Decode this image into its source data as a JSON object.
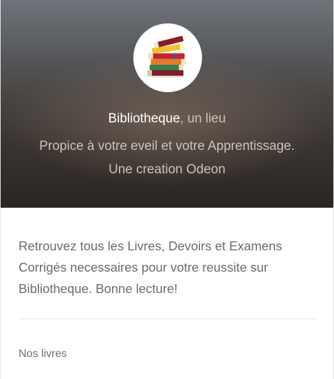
{
  "hero": {
    "brand": "Bibliotheque",
    "line1_rest": ", un lieu",
    "line2": "Propice à votre eveil et votre Apprentissage.",
    "line3": "Une creation Odeon",
    "logo_icon": "stack-of-books-icon"
  },
  "content": {
    "description": "Retrouvez tous les Livres, Devoirs et Examens Corrigés necessaires pour votre reussite sur Bibliotheque. Bonne lecture!",
    "nav_link": "Nos livres"
  },
  "colors": {
    "hero_dark": "#2a2522",
    "hero_light": "#6f7379",
    "text_muted": "#6b6b6b",
    "brand_text": "#ffffff"
  }
}
